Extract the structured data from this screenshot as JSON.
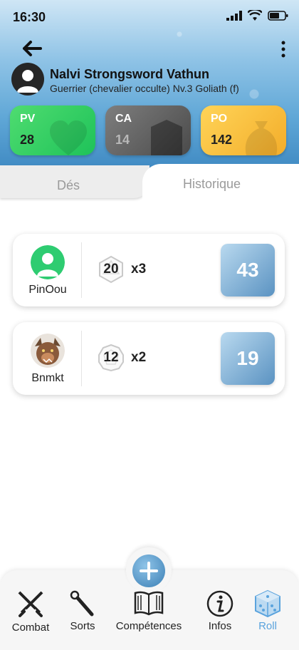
{
  "status_bar": {
    "time": "16:30"
  },
  "character": {
    "name": "Nalvi Strongsword Vathun",
    "subtitle": "Guerrier (chevalier occulte) Nv.3 Goliath (f)"
  },
  "stats": [
    {
      "label": "PV",
      "value": "28",
      "color": "#2ecc64"
    },
    {
      "label": "CA",
      "value": "14",
      "color": "#5c5c5c"
    },
    {
      "label": "PO",
      "value": "142",
      "color": "#f7be3b"
    }
  ],
  "tabs": {
    "dice": "Dés",
    "history": "Historique"
  },
  "rolls": [
    {
      "user": "PinOou",
      "die": "20",
      "multiplier": "x3",
      "result": "43",
      "avatar": "default-user-avatar"
    },
    {
      "user": "Bnmkt",
      "die": "12",
      "multiplier": "x2",
      "result": "19",
      "avatar": "monster-avatar"
    }
  ],
  "nav": {
    "items": [
      {
        "label": "Combat",
        "icon": "crossed-swords-icon"
      },
      {
        "label": "Sorts",
        "icon": "wand-icon"
      },
      {
        "label": "Compétences",
        "icon": "book-icon"
      },
      {
        "label": "Infos",
        "icon": "info-icon"
      },
      {
        "label": "Roll",
        "icon": "dice-icon",
        "active": true
      }
    ],
    "fab_icon": "plus-icon"
  },
  "colors": {
    "accent": "#5aa3dd",
    "header": "#5ea6d6"
  }
}
